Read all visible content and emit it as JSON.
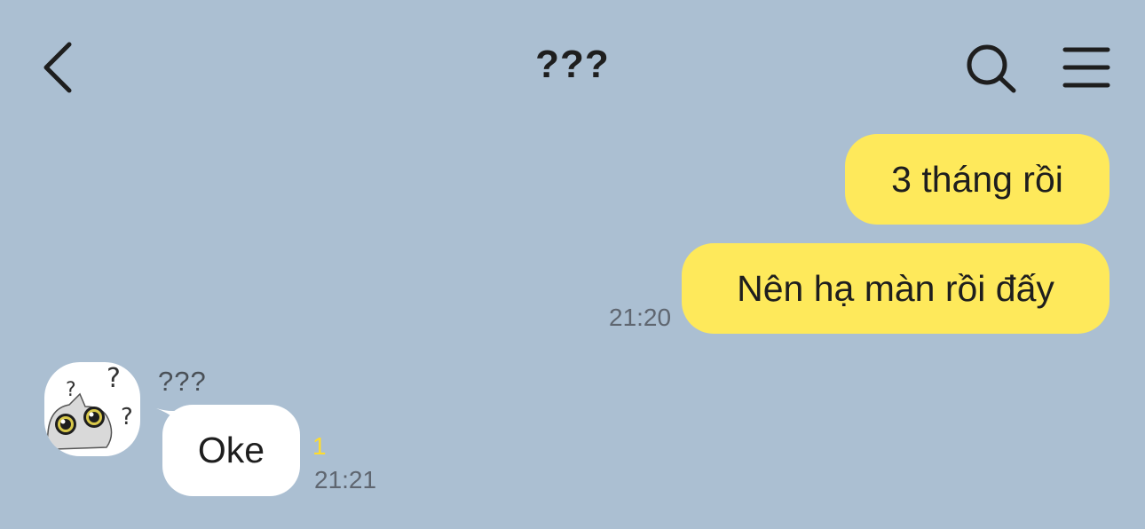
{
  "header": {
    "title": "???",
    "back_icon": "chevron-left-icon",
    "search_icon": "search-icon",
    "menu_icon": "hamburger-menu-icon"
  },
  "messages": {
    "outgoing": [
      {
        "text": "3 tháng rồi"
      },
      {
        "text": "Nên hạ màn rồi đấy",
        "time": "21:20"
      }
    ],
    "incoming": [
      {
        "sender": "???",
        "text": "Oke",
        "unread": "1",
        "time": "21:21",
        "avatar_icon": "confused-cat-avatar-icon"
      }
    ]
  },
  "colors": {
    "background": "#abbfd2",
    "outgoing_bubble": "#fee95b",
    "incoming_bubble": "#ffffff",
    "unread": "#fedc2e"
  }
}
